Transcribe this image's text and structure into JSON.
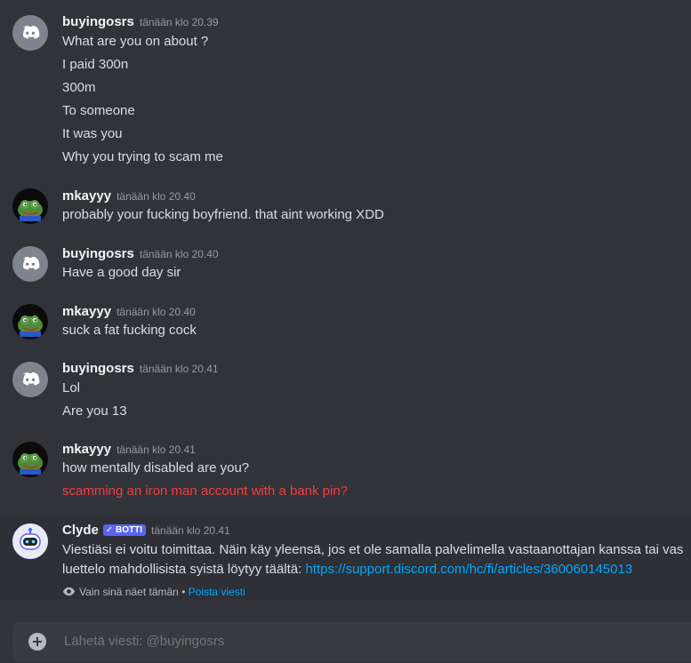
{
  "messages": [
    {
      "user": "buyingosrs",
      "timestamp": "tänään klo 20.39",
      "avatar": "discord-avatar-icon",
      "lines": [
        "What are you on about ?",
        "I paid 300n",
        "300m",
        "To someone",
        "It was you",
        "Why you trying to scam me"
      ]
    },
    {
      "user": "mkayyy",
      "timestamp": "tänään klo 20.40",
      "avatar": "pepe-avatar-icon",
      "lines": [
        "probably your fucking boyfriend. that aint working XDD"
      ]
    },
    {
      "user": "buyingosrs",
      "timestamp": "tänään klo 20.40",
      "avatar": "discord-avatar-icon",
      "lines": [
        "Have a good day sir"
      ]
    },
    {
      "user": "mkayyy",
      "timestamp": "tänään klo 20.40",
      "avatar": "pepe-avatar-icon",
      "lines": [
        "suck a fat fucking cock"
      ]
    },
    {
      "user": "buyingosrs",
      "timestamp": "tänään klo 20.41",
      "avatar": "discord-avatar-icon",
      "lines": [
        "Lol",
        "Are you 13"
      ]
    },
    {
      "user": "mkayyy",
      "timestamp": "tänään klo 20.41",
      "avatar": "pepe-avatar-icon",
      "lines": [
        "how mentally disabled are you?"
      ],
      "error_line": "scamming an iron man account with a bank pin?"
    }
  ],
  "clyde": {
    "user": "Clyde",
    "badge": "BOTTI",
    "timestamp": "tänään klo 20.41",
    "avatar": "clyde-bot-icon",
    "line1": "Viestiäsi ei voitu toimittaa. Näin käy yleensä, jos et ole samalla palvelimella vastaanottajan kanssa tai vas",
    "line2_text": "luettelo mahdollisista syistä löytyy täältä: ",
    "link": "https://support.discord.com/hc/fi/articles/360060145013",
    "only_you": "Vain sinä näet tämän",
    "separator": " • ",
    "dismiss": "Poista viesti"
  },
  "composer": {
    "placeholder": "Lähetä viesti: @buyingosrs"
  },
  "colors": {
    "background": "#313338",
    "error_text": "#f23f43",
    "link": "#00a8fc",
    "bot_badge": "#5865f2"
  }
}
